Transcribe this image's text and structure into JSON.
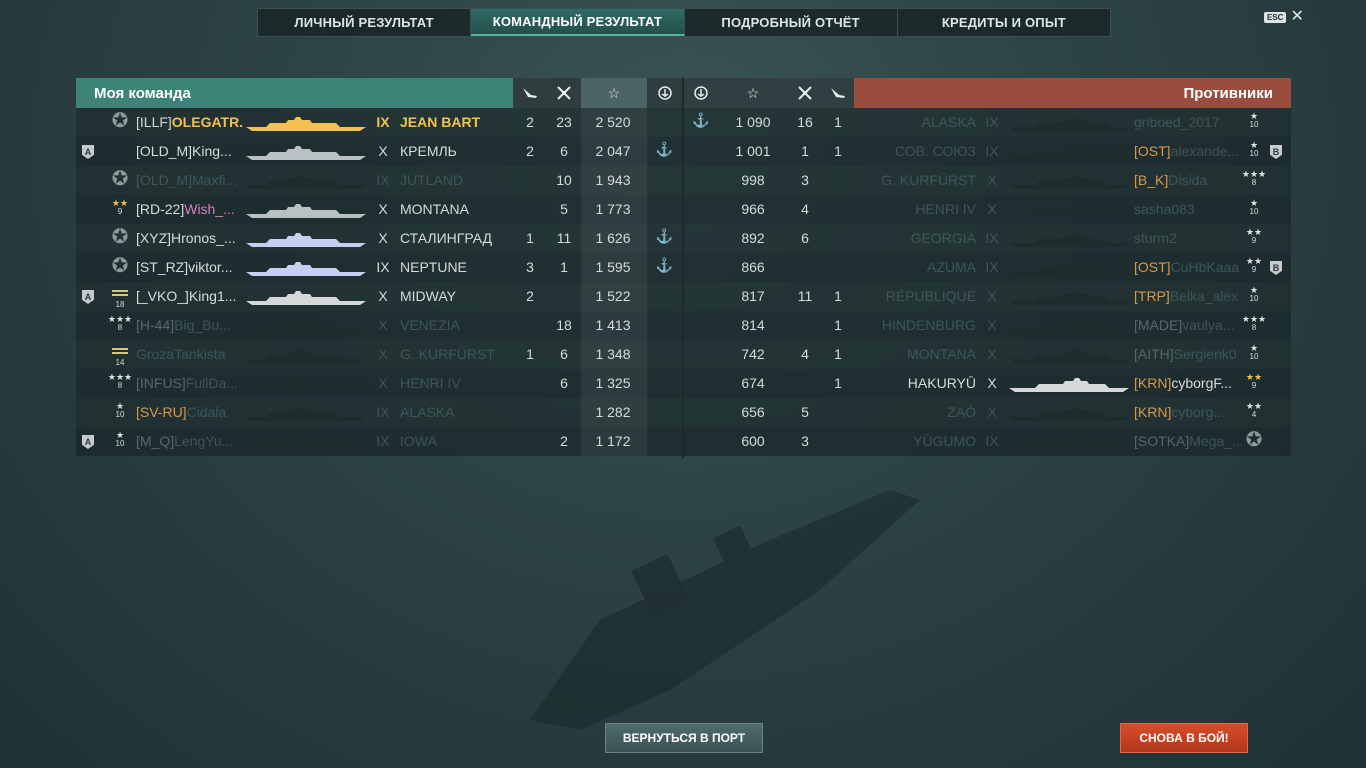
{
  "tabs": [
    "ЛИЧНЫЙ РЕЗУЛЬТАТ",
    "КОМАНДНЫЙ РЕЗУЛЬТАТ",
    "ПОДРОБНЫЙ ОТЧЁТ",
    "КРЕДИТЫ И ОПЫТ"
  ],
  "active_tab": "КОМАНДНЫЙ РЕЗУЛЬТАТ",
  "esc_label": "ESC",
  "my_team_title": "Моя команда",
  "enemy_team_title": "Противники",
  "colors": {
    "my_team_header": "#3d8377",
    "enemy_header": "#9a4d3d",
    "highlight": "#f2c14f",
    "return_button": "#4f6b6c",
    "battle_button": "#d94b2a"
  },
  "my_team": [
    {
      "division": "",
      "rank": "star-silver",
      "rank_level": "",
      "clan": "[ILLF]",
      "name": "OLEGATR...",
      "tier": "IX",
      "ship": "JEAN BART",
      "planes": "2",
      "frags": "23",
      "xp": "2 520",
      "medal": "",
      "style": "self",
      "ship_color": "#f2c14f"
    },
    {
      "division": "A",
      "rank": "",
      "rank_level": "",
      "clan": "[OLD_M]",
      "name": "King...",
      "tier": "X",
      "ship": "КРЕМЛЬ",
      "planes": "2",
      "frags": "6",
      "xp": "2 047",
      "medal": "medal",
      "style": "alive",
      "ship_color": "#b9c1c2"
    },
    {
      "division": "",
      "rank": "star-silver",
      "rank_level": "",
      "clan": "[OLD_M]",
      "name": "Maxfi...",
      "tier": "IX",
      "ship": "JUTLAND",
      "planes": "",
      "frags": "10",
      "xp": "1 943",
      "medal": "",
      "style": "dead",
      "ship_color": "#1e2c2e"
    },
    {
      "division": "",
      "rank": "★★",
      "rank_level": "9",
      "clan": "[RD-22]",
      "name": "Wish_...",
      "tier": "X",
      "ship": "MONTANA",
      "planes": "",
      "frags": "5",
      "xp": "1 773",
      "medal": "",
      "style": "alive-pink",
      "ship_color": "#b9c1c2"
    },
    {
      "division": "",
      "rank": "star-silver",
      "rank_level": "",
      "clan": "[XYZ]",
      "name": "Hronos_...",
      "tier": "X",
      "ship": "СТАЛИНГРАД",
      "planes": "1",
      "frags": "11",
      "xp": "1 626",
      "medal": "medal",
      "style": "alive",
      "ship_color": "#c4cff2"
    },
    {
      "division": "",
      "rank": "star-silver",
      "rank_level": "",
      "clan": "[ST_RZ]",
      "name": "viktor...",
      "tier": "IX",
      "ship": "NEPTUNE",
      "planes": "3",
      "frags": "1",
      "xp": "1 595",
      "medal": "medal",
      "style": "alive",
      "ship_color": "#c4cff2"
    },
    {
      "division": "A",
      "rank": "stripes",
      "rank_level": "18",
      "clan": "[_VKO_]",
      "name": "King1...",
      "tier": "X",
      "ship": "MIDWAY",
      "planes": "2",
      "frags": "",
      "xp": "1 522",
      "medal": "",
      "style": "alive",
      "ship_color": "#d4d8d9"
    },
    {
      "division": "",
      "rank": "★★★",
      "rank_level": "8",
      "clan": "[H-44]",
      "name": "Big_Bu...",
      "tier": "X",
      "ship": "VENEZIA",
      "planes": "",
      "frags": "18",
      "xp": "1 413",
      "medal": "",
      "style": "dead-clan",
      "ship_color": "#1e2c2e"
    },
    {
      "division": "",
      "rank": "stripes",
      "rank_level": "14",
      "clan": "",
      "name": "GrozaTankista",
      "tier": "X",
      "ship": "G. KURFÜRST",
      "planes": "1",
      "frags": "6",
      "xp": "1 348",
      "medal": "",
      "style": "dead",
      "ship_color": "#1e2c2e"
    },
    {
      "division": "",
      "rank": "★★★",
      "rank_level": "8",
      "clan": "[INFUS]",
      "name": "FullDa...",
      "tier": "X",
      "ship": "HENRI IV",
      "planes": "",
      "frags": "6",
      "xp": "1 325",
      "medal": "",
      "style": "dead-clan",
      "ship_color": "#1e2c2e"
    },
    {
      "division": "",
      "rank": "★",
      "rank_level": "10",
      "clan": "[SV-RU]",
      "name": "Cidala",
      "tier": "IX",
      "ship": "ALASKA",
      "planes": "",
      "frags": "",
      "xp": "1 282",
      "medal": "",
      "style": "dead-orange",
      "ship_color": "#1e2c2e"
    },
    {
      "division": "A",
      "rank": "★",
      "rank_level": "10",
      "clan": "[M_Q]",
      "name": "LengYu...",
      "tier": "IX",
      "ship": "IOWA",
      "planes": "",
      "frags": "2",
      "xp": "1 172",
      "medal": "",
      "style": "dead-clan",
      "ship_color": "#1e2c2e"
    }
  ],
  "enemy_team": [
    {
      "medal": "medal",
      "xp": "1 090",
      "frags": "16",
      "planes": "1",
      "ship": "ALASKA",
      "tier": "IX",
      "clan": "",
      "name": "griboed_2017",
      "rank": "★",
      "rank_level": "10",
      "division": "",
      "style": "dead",
      "ship_color": "#1e2c2e"
    },
    {
      "medal": "",
      "xp": "1 001",
      "frags": "1",
      "planes": "1",
      "ship": "СОВ. СОЮЗ",
      "tier": "IX",
      "clan": "[OST]",
      "name": "alexande...",
      "rank": "★",
      "rank_level": "10",
      "division": "B",
      "style": "dead-orange",
      "ship_color": "#1e2c2e"
    },
    {
      "medal": "",
      "xp": "998",
      "frags": "3",
      "planes": "",
      "ship": "G. KURFÜRST",
      "tier": "X",
      "clan": "[B_K]",
      "name": "Disida",
      "rank": "★★★",
      "rank_level": "8",
      "division": "",
      "style": "dead-orange",
      "ship_color": "#1e2c2e"
    },
    {
      "medal": "",
      "xp": "966",
      "frags": "4",
      "planes": "",
      "ship": "HENRI IV",
      "tier": "X",
      "clan": "",
      "name": "sasha083",
      "rank": "★",
      "rank_level": "10",
      "division": "",
      "style": "dead",
      "ship_color": "#1e2c2e"
    },
    {
      "medal": "",
      "xp": "892",
      "frags": "6",
      "planes": "",
      "ship": "GEORGIA",
      "tier": "IX",
      "clan": "",
      "name": "sturm2",
      "rank": "★★",
      "rank_level": "9",
      "division": "",
      "style": "dead",
      "ship_color": "#1e2c2e"
    },
    {
      "medal": "",
      "xp": "866",
      "frags": "",
      "planes": "",
      "ship": "AZUMA",
      "tier": "IX",
      "clan": "[OST]",
      "name": "CuHbKaaa",
      "rank": "★★",
      "rank_level": "9",
      "division": "B",
      "style": "dead-orange",
      "ship_color": "#1e2c2e"
    },
    {
      "medal": "",
      "xp": "817",
      "frags": "11",
      "planes": "1",
      "ship": "RÉPUBLIQUE",
      "tier": "X",
      "clan": "[TRP]",
      "name": "Belka_alex",
      "rank": "★",
      "rank_level": "10",
      "division": "",
      "style": "dead-orange",
      "ship_color": "#1e2c2e"
    },
    {
      "medal": "",
      "xp": "814",
      "frags": "",
      "planes": "1",
      "ship": "HINDENBURG",
      "tier": "X",
      "clan": "[MADE]",
      "name": "vaulya...",
      "rank": "★★★",
      "rank_level": "8",
      "division": "",
      "style": "dead-clan",
      "ship_color": "#1e2c2e"
    },
    {
      "medal": "",
      "xp": "742",
      "frags": "4",
      "planes": "1",
      "ship": "MONTANA",
      "tier": "X",
      "clan": "[AITH]",
      "name": "Sergienk0",
      "rank": "★",
      "rank_level": "10",
      "division": "",
      "style": "dead-clan",
      "ship_color": "#1e2c2e"
    },
    {
      "medal": "",
      "xp": "674",
      "frags": "",
      "planes": "1",
      "ship": "HAKURYŪ",
      "tier": "X",
      "clan": "[KRN]",
      "name": "cyborgF...",
      "rank": "★★",
      "rank_level": "9",
      "division": "",
      "style": "alive-orange",
      "ship_color": "#d4d8d9"
    },
    {
      "medal": "",
      "xp": "656",
      "frags": "5",
      "planes": "",
      "ship": "ZAŌ",
      "tier": "X",
      "clan": "[KRN]",
      "name": "cyborg...",
      "rank": "★★",
      "rank_level": "4",
      "division": "",
      "style": "dead-orange",
      "ship_color": "#1e2c2e"
    },
    {
      "medal": "",
      "xp": "600",
      "frags": "3",
      "planes": "",
      "ship": "YŪGUMO",
      "tier": "IX",
      "clan": "[SOTKA]",
      "name": "Mega_...",
      "rank": "star-silver",
      "rank_level": "",
      "division": "",
      "style": "dead-clan",
      "ship_color": "#1e2c2e"
    }
  ],
  "buttons": {
    "return_port": "ВЕРНУТЬСЯ В ПОРТ",
    "battle_again": "СНОВА В БОЙ!"
  }
}
